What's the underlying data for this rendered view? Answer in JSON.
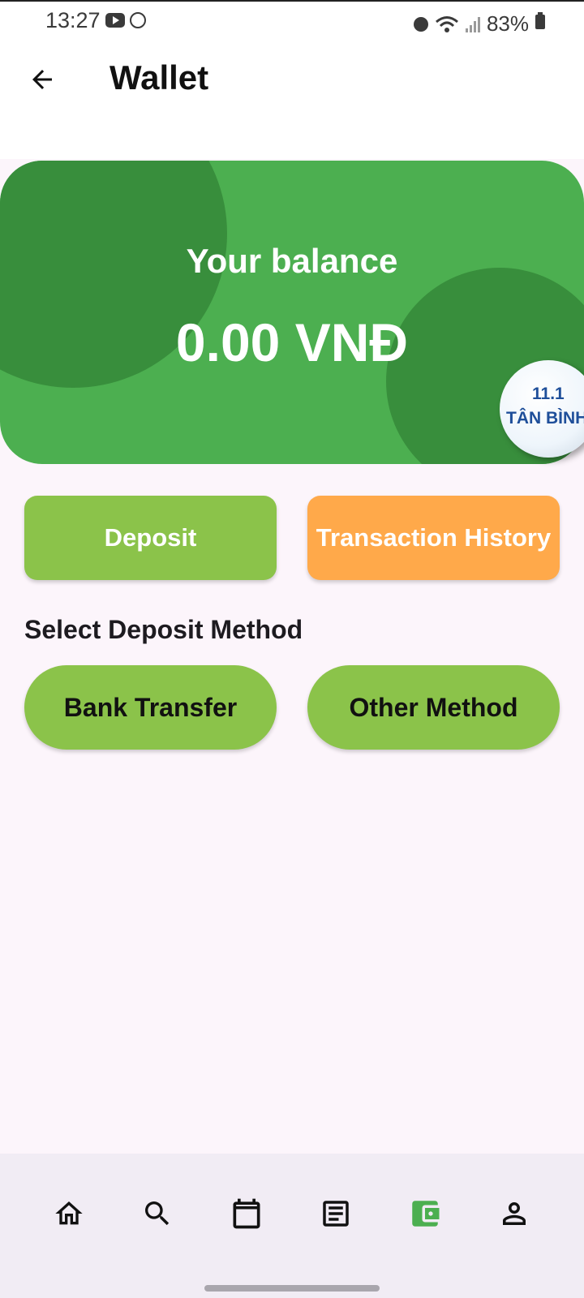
{
  "status_bar": {
    "time": "13:27",
    "battery": "83%"
  },
  "header": {
    "title": "Wallet"
  },
  "balance_card": {
    "label": "Your balance",
    "amount": "0.00 VNĐ",
    "badge_line1": "11.1",
    "badge_line2": "TÂN BÌNH"
  },
  "actions": {
    "deposit": "Deposit",
    "history": "Transaction History"
  },
  "deposit_methods": {
    "title": "Select Deposit Method",
    "bank": "Bank Transfer",
    "other": "Other Method"
  },
  "bottom_nav": {
    "items": [
      {
        "icon": "home-icon",
        "active": false
      },
      {
        "icon": "search-icon",
        "active": false
      },
      {
        "icon": "calendar-icon",
        "active": false
      },
      {
        "icon": "article-icon",
        "active": false
      },
      {
        "icon": "wallet-icon",
        "active": true
      },
      {
        "icon": "person-icon",
        "active": false
      }
    ]
  },
  "colors": {
    "card_green": "#4caf50",
    "card_dark_green": "#388e3c",
    "button_green": "#8bc34a",
    "button_orange": "#ffa94a",
    "nav_active": "#4caf50"
  }
}
